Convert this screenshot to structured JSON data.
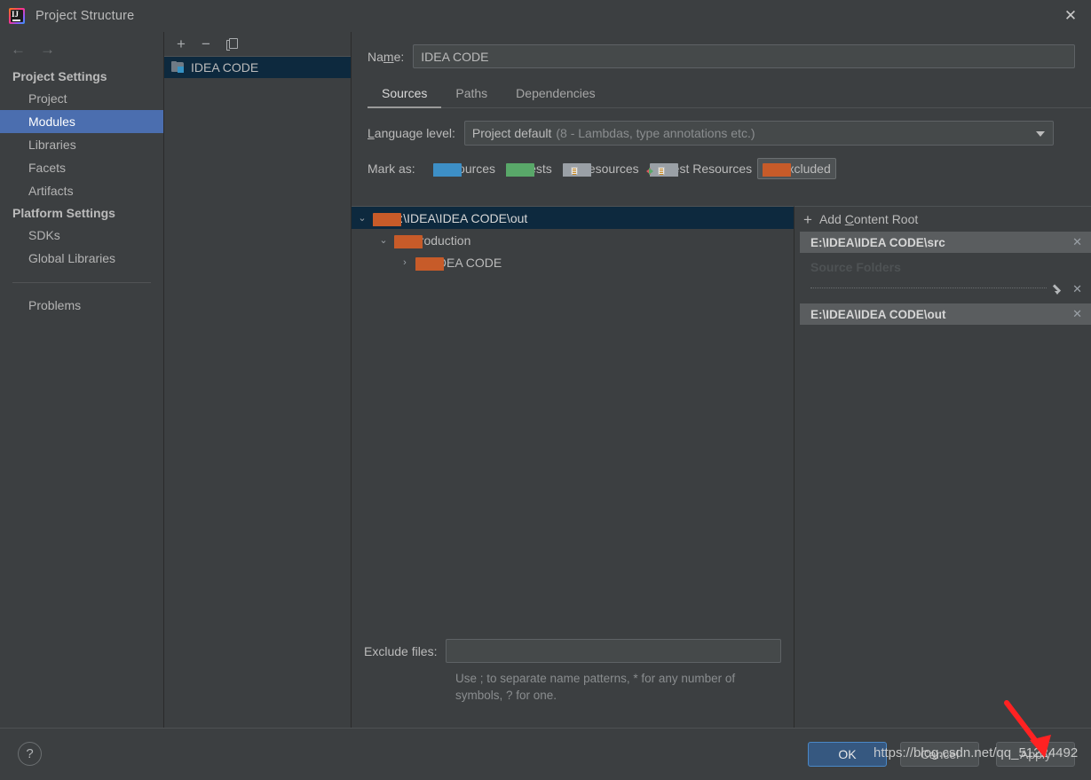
{
  "window": {
    "title": "Project Structure",
    "app_icon": "intellij-idea-icon",
    "close_icon": "close-icon"
  },
  "sidebar": {
    "back_icon": "arrow-left-icon",
    "forward_icon": "arrow-right-icon",
    "groups": [
      {
        "label": "Project Settings",
        "items": [
          {
            "label": "Project",
            "selected": false
          },
          {
            "label": "Modules",
            "selected": true
          },
          {
            "label": "Libraries",
            "selected": false
          },
          {
            "label": "Facets",
            "selected": false
          },
          {
            "label": "Artifacts",
            "selected": false
          }
        ]
      },
      {
        "label": "Platform Settings",
        "items": [
          {
            "label": "SDKs",
            "selected": false
          },
          {
            "label": "Global Libraries",
            "selected": false
          }
        ]
      }
    ],
    "problems_label": "Problems"
  },
  "modules_panel": {
    "toolbar": {
      "add_label": "+",
      "remove_label": "−",
      "copy_icon": "copy-icon"
    },
    "items": [
      {
        "label": "IDEA CODE",
        "selected": true,
        "icon": "module-folder-icon"
      }
    ]
  },
  "details": {
    "name_label": "Na",
    "name_label_mnemonic": "m",
    "name_label_rest": "e:",
    "name_value": "IDEA CODE",
    "tabs": [
      {
        "label": "Sources",
        "active": true
      },
      {
        "label": "Paths",
        "active": false
      },
      {
        "label": "Dependencies",
        "active": false
      }
    ],
    "language_level": {
      "label_prefix": "L",
      "label_mnemonic": "L",
      "label": "anguage level:",
      "value_main": "Project default",
      "value_sub": "(8 - Lambdas, type annotations etc.)",
      "dropdown_icon": "chevron-down-icon"
    },
    "mark_as": {
      "label": "Mark as:",
      "options": [
        {
          "label": "Sources",
          "mnemonic": "S",
          "rest": "ources",
          "color": "blue",
          "pressed": false
        },
        {
          "label": "Tests",
          "mnemonic": "T",
          "rest": "ests",
          "color": "green",
          "pressed": false
        },
        {
          "label": "Resources",
          "mnemonic": "",
          "rest": "Resources",
          "color": "gray",
          "pressed": false
        },
        {
          "label": "Test Resources",
          "mnemonic": "",
          "rest": "Test Resources",
          "color": "gray",
          "pressed": false
        },
        {
          "label": "Excluded",
          "mnemonic": "E",
          "rest": "xcluded",
          "color": "orange",
          "pressed": true
        }
      ]
    }
  },
  "tree": {
    "rows": [
      {
        "label": "E:\\IDEA\\IDEA CODE\\out",
        "depth": 0,
        "twisty": "⌄",
        "selected": true,
        "icon": "folder-orange-icon"
      },
      {
        "label": "production",
        "depth": 1,
        "twisty": "⌄",
        "selected": false,
        "icon": "folder-orange-icon"
      },
      {
        "label": "IDEA CODE",
        "depth": 2,
        "twisty": "›",
        "selected": false,
        "icon": "folder-orange-icon"
      }
    ]
  },
  "exclude": {
    "label": "Exclude files:",
    "value": "",
    "hint": "Use ; to separate name patterns, * for any number of symbols, ? for one."
  },
  "content_roots": {
    "add_label_prefix": "Add ",
    "add_mnemonic": "C",
    "add_label_rest": "ontent Root",
    "add_icon": "plus-icon",
    "entries": [
      {
        "path": "E:\\IDEA\\IDEA CODE\\src",
        "remove_icon": "close-icon",
        "section_title": "Source Folders",
        "has_dotted_row": true,
        "edit_icon": "pencil-icon",
        "delete_icon": "close-icon"
      },
      {
        "path": "E:\\IDEA\\IDEA CODE\\out",
        "remove_icon": "close-icon",
        "section_title": "",
        "has_dotted_row": false
      }
    ]
  },
  "footer": {
    "help_label": "?",
    "ok_label": "OK",
    "cancel_label": "Cancel",
    "apply_label": "Apply"
  },
  "annotations": {
    "watermark": "https://blog.csdn.net/qq_51224492",
    "arrow_color": "#ff2222"
  }
}
